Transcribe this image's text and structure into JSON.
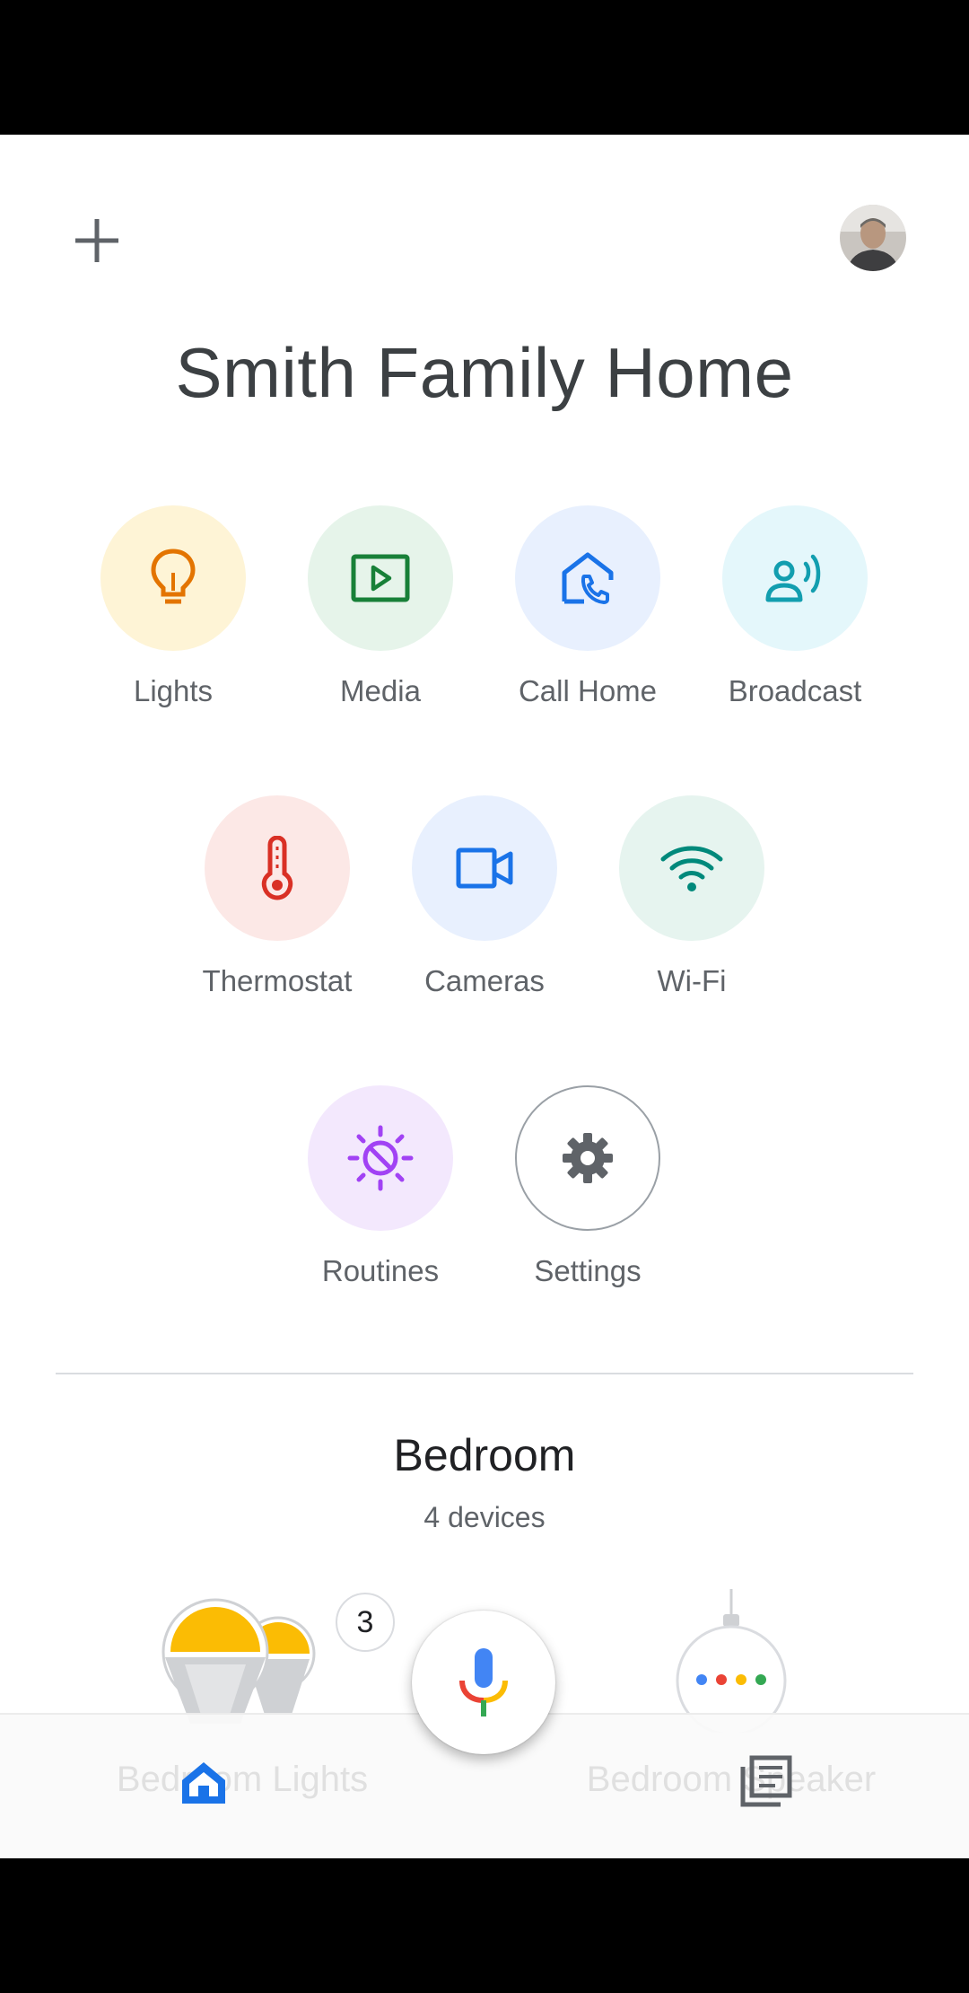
{
  "header": {
    "home_name": "Smith Family Home"
  },
  "actions": [
    {
      "label": "Lights",
      "icon": "lightbulb-icon",
      "bg": "#fef4d6",
      "fg": "#e37400"
    },
    {
      "label": "Media",
      "icon": "play-box-icon",
      "bg": "#e6f4ea",
      "fg": "#188038"
    },
    {
      "label": "Call Home",
      "icon": "home-phone-icon",
      "bg": "#e8f0fe",
      "fg": "#1a73e8"
    },
    {
      "label": "Broadcast",
      "icon": "broadcast-icon",
      "bg": "#e4f7fb",
      "fg": "#129eaf"
    },
    {
      "label": "Thermostat",
      "icon": "thermometer-icon",
      "bg": "#fce8e6",
      "fg": "#d93025"
    },
    {
      "label": "Cameras",
      "icon": "videocam-icon",
      "bg": "#e8f0fe",
      "fg": "#1a73e8"
    },
    {
      "label": "Wi-Fi",
      "icon": "wifi-icon",
      "bg": "#e6f4ef",
      "fg": "#00897b"
    },
    {
      "label": "Routines",
      "icon": "routines-icon",
      "bg": "#f3e8fd",
      "fg": "#a142f4"
    },
    {
      "label": "Settings",
      "icon": "gear-icon",
      "bg": "#ffffff",
      "fg": "#5f6368"
    }
  ],
  "room": {
    "name": "Bedroom",
    "device_count": "4 devices",
    "devices": [
      {
        "name": "Bedroom Lights",
        "badge": "3"
      },
      {
        "name": "Bedroom Speaker"
      }
    ]
  },
  "nav": {
    "home_icon": "home-icon",
    "feed_icon": "feed-icon",
    "mic_icon": "mic-icon"
  }
}
